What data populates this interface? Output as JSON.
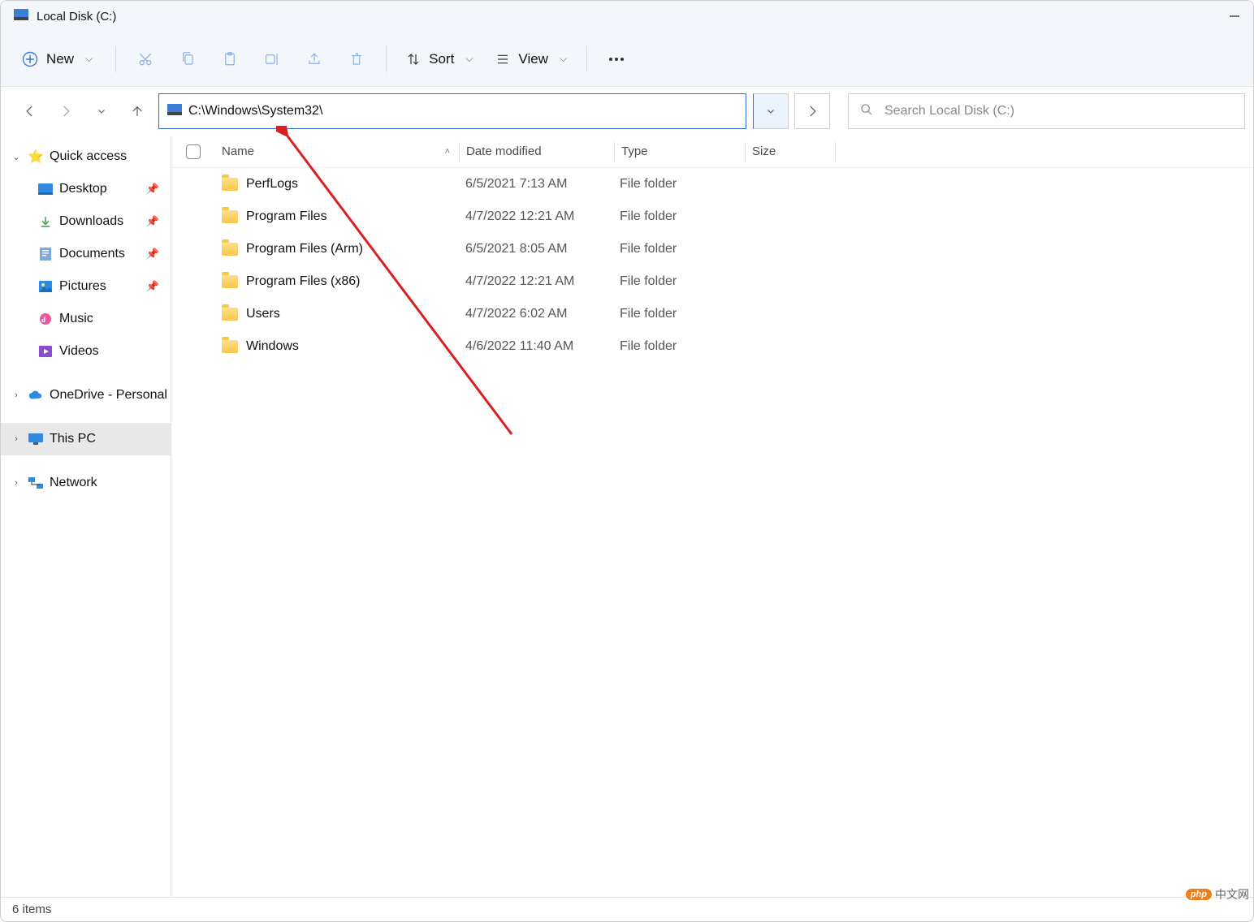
{
  "window": {
    "title": "Local Disk (C:)"
  },
  "toolbar": {
    "new_label": "New",
    "sort_label": "Sort",
    "view_label": "View"
  },
  "addressbar": {
    "path": "C:\\Windows\\System32\\"
  },
  "search": {
    "placeholder": "Search Local Disk (C:)"
  },
  "sidebar": {
    "quick_access": "Quick access",
    "desktop": "Desktop",
    "downloads": "Downloads",
    "documents": "Documents",
    "pictures": "Pictures",
    "music": "Music",
    "videos": "Videos",
    "onedrive": "OneDrive - Personal",
    "thispc": "This PC",
    "network": "Network"
  },
  "columns": {
    "name": "Name",
    "date": "Date modified",
    "type": "Type",
    "size": "Size"
  },
  "rows": [
    {
      "name": "PerfLogs",
      "date": "6/5/2021 7:13 AM",
      "type": "File folder"
    },
    {
      "name": "Program Files",
      "date": "4/7/2022 12:21 AM",
      "type": "File folder"
    },
    {
      "name": "Program Files (Arm)",
      "date": "6/5/2021 8:05 AM",
      "type": "File folder"
    },
    {
      "name": "Program Files (x86)",
      "date": "4/7/2022 12:21 AM",
      "type": "File folder"
    },
    {
      "name": "Users",
      "date": "4/7/2022 6:02 AM",
      "type": "File folder"
    },
    {
      "name": "Windows",
      "date": "4/6/2022 11:40 AM",
      "type": "File folder"
    }
  ],
  "statusbar": {
    "items": "6 items"
  },
  "watermark": {
    "brand": "php",
    "text": "中文网"
  }
}
